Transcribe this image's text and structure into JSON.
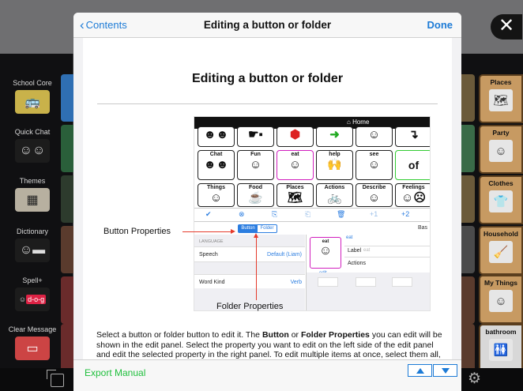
{
  "background": {
    "left_buttons": [
      {
        "label": "School Core",
        "icon": "school-bus-icon"
      },
      {
        "label": "Quick Chat",
        "icon": "chat-faces-icon"
      },
      {
        "label": "Themes",
        "icon": "themes-icon"
      },
      {
        "label": "Dictionary",
        "icon": "book-icon"
      },
      {
        "label": "Spell+",
        "icon": "spell-icon",
        "picture_text": "d-o-g"
      },
      {
        "label": "Clear Message",
        "icon": "eraser-icon"
      }
    ],
    "right_buttons": [
      {
        "label": "Places",
        "icon": "map-icon"
      },
      {
        "label": "Party",
        "icon": "party-icon"
      },
      {
        "label": "Clothes",
        "icon": "clothes-icon"
      },
      {
        "label": "Household",
        "icon": "broom-icon"
      },
      {
        "label": "My Things",
        "icon": "my-things-icon"
      },
      {
        "label": "bathroom",
        "icon": "bathroom-icon"
      }
    ],
    "close_icon": "close-icon",
    "settings_icon": "gear-icon"
  },
  "modal": {
    "back_label": "Contents",
    "title": "Editing a button or folder",
    "done_label": "Done",
    "page_heading": "Editing a button or folder",
    "screenshot": {
      "home_label": "Home",
      "tiles": [
        "Chat",
        "Fun",
        "eat",
        "help",
        "see",
        "of",
        "Things",
        "Food",
        "Places",
        "Actions",
        "Describe",
        "Feelings"
      ],
      "toolbar_items": [
        "+1",
        "+2"
      ],
      "segment": [
        "Button",
        "Folder"
      ],
      "right_header": "Bas",
      "section_label": "LANGUAGE",
      "rows": [
        {
          "label": "Speech",
          "value": "Default (Liam)"
        },
        {
          "label": "Word Kind",
          "value": "Verb"
        }
      ],
      "preview_label": "eat",
      "preview_caption": "eat",
      "preview_edit": "edit",
      "field_label": "Label",
      "field_value": "eat",
      "actions_label": "Actions"
    },
    "annotation_button": "Button Properties",
    "annotation_folder": "Folder Properties",
    "paragraph_parts": [
      "Select a button or folder button to edit it. The ",
      "Button",
      " or ",
      "Folder Properties",
      " you can edit will be shown in the edit panel. Select the property you want to edit on the left side of the edit panel and edit the selected property in the right panel. To edit multiple items at once, select them all, but note that you can only edit some properties for multiple items at once."
    ],
    "footer_link": "Export Manual"
  },
  "colors": {
    "accent_blue": "#1d7bd6",
    "export_green": "#1fbf3c",
    "annotation_red": "#e53a2b"
  }
}
